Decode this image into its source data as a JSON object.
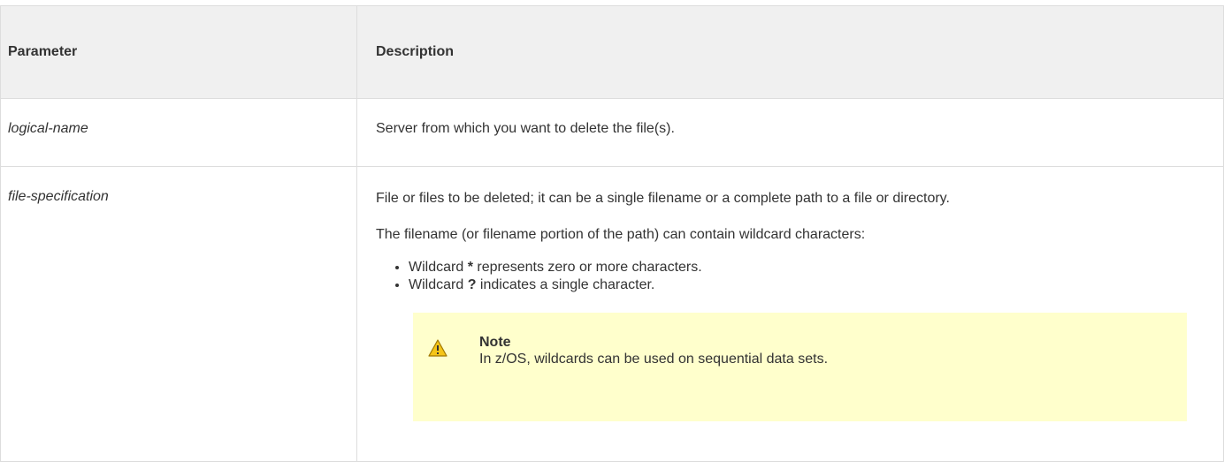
{
  "header": {
    "parameter": "Parameter",
    "description": "Description"
  },
  "rows": [
    {
      "name": "logical-name",
      "description": "Server from which you want to delete the file(s)."
    },
    {
      "name": "file-specification",
      "description": "File or files to be deleted; it can be a single filename or a complete path to a file or directory.",
      "wildcard_intro": "The filename (or filename portion of the path) can contain wildcard characters:",
      "wildcards": [
        {
          "prefix": "Wildcard ",
          "symbol": "*",
          "suffix": " represents zero or more characters."
        },
        {
          "prefix": "Wildcard ",
          "symbol": "?",
          "suffix": " indicates a single character."
        }
      ],
      "note": {
        "title": "Note",
        "text": "In z/OS, wildcards can be used on sequential data sets.",
        "icon": "warning-icon",
        "background": "#ffffcc"
      }
    }
  ]
}
